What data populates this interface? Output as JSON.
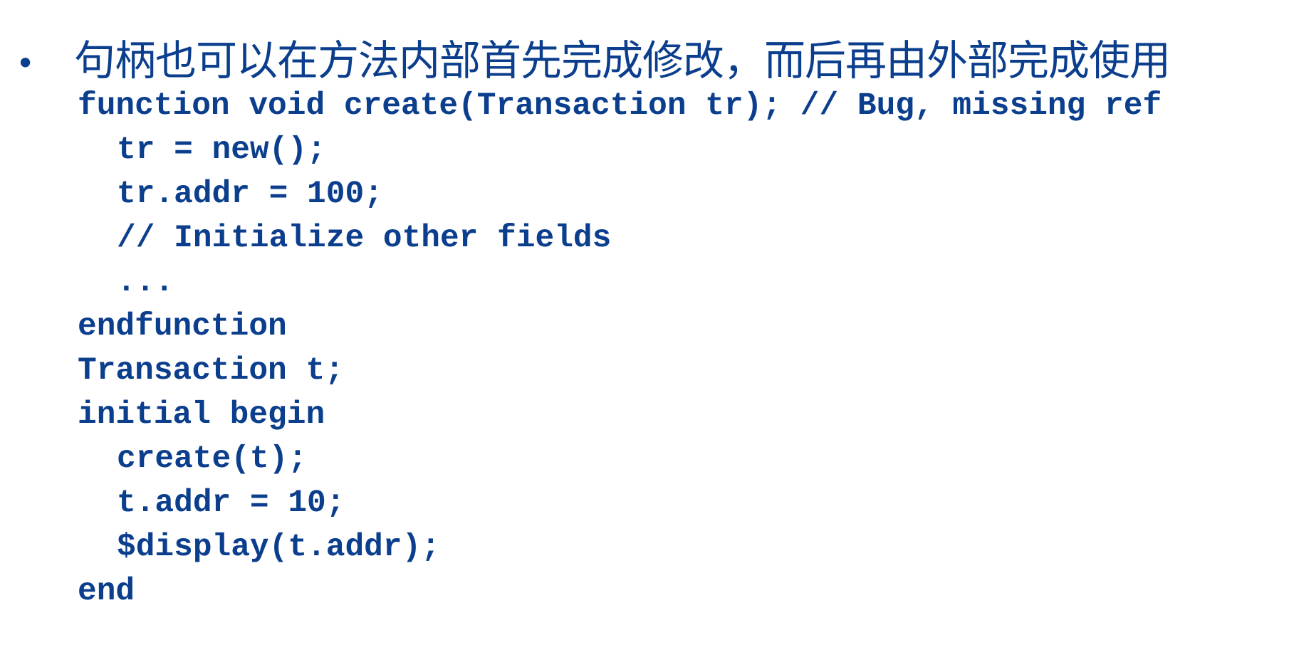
{
  "bullet": {
    "marker": "•",
    "text": "句柄也可以在方法内部首先完成修改，而后再由外部完成使用"
  },
  "code_lines": [
    "function void create(Transaction tr); // Bug, missing ref",
    "tr = new();",
    "tr.addr = 100;",
    "// Initialize other fields",
    "...",
    "endfunction",
    "Transaction t;",
    "initial begin",
    "create(t);",
    "t.addr = 10;",
    "$display(t.addr);",
    "end"
  ]
}
